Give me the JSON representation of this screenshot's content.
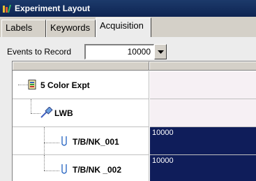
{
  "window": {
    "title": "Experiment Layout",
    "app_icon": "experiment-layout-icon"
  },
  "tabs": [
    {
      "label": "Labels",
      "active": false
    },
    {
      "label": "Keywords",
      "active": false
    },
    {
      "label": "Acquisition",
      "active": true
    }
  ],
  "events": {
    "label": "Events to Record",
    "value": "10000"
  },
  "tree": {
    "rows": [
      {
        "label": "5 Color  Expt",
        "icon": "experiment-icon",
        "value": ""
      },
      {
        "label": "LWB",
        "icon": "pipette-icon",
        "value": ""
      },
      {
        "label": "T/B/NK_001",
        "icon": "tube-icon",
        "value": "10000"
      },
      {
        "label": "T/B/NK _002",
        "icon": "tube-icon",
        "value": "10000"
      }
    ]
  },
  "colors": {
    "title_bg": "#0e2452",
    "selected_cell_bg": "#0f1d5a",
    "empty_cell_bg": "#f6f0f4"
  }
}
